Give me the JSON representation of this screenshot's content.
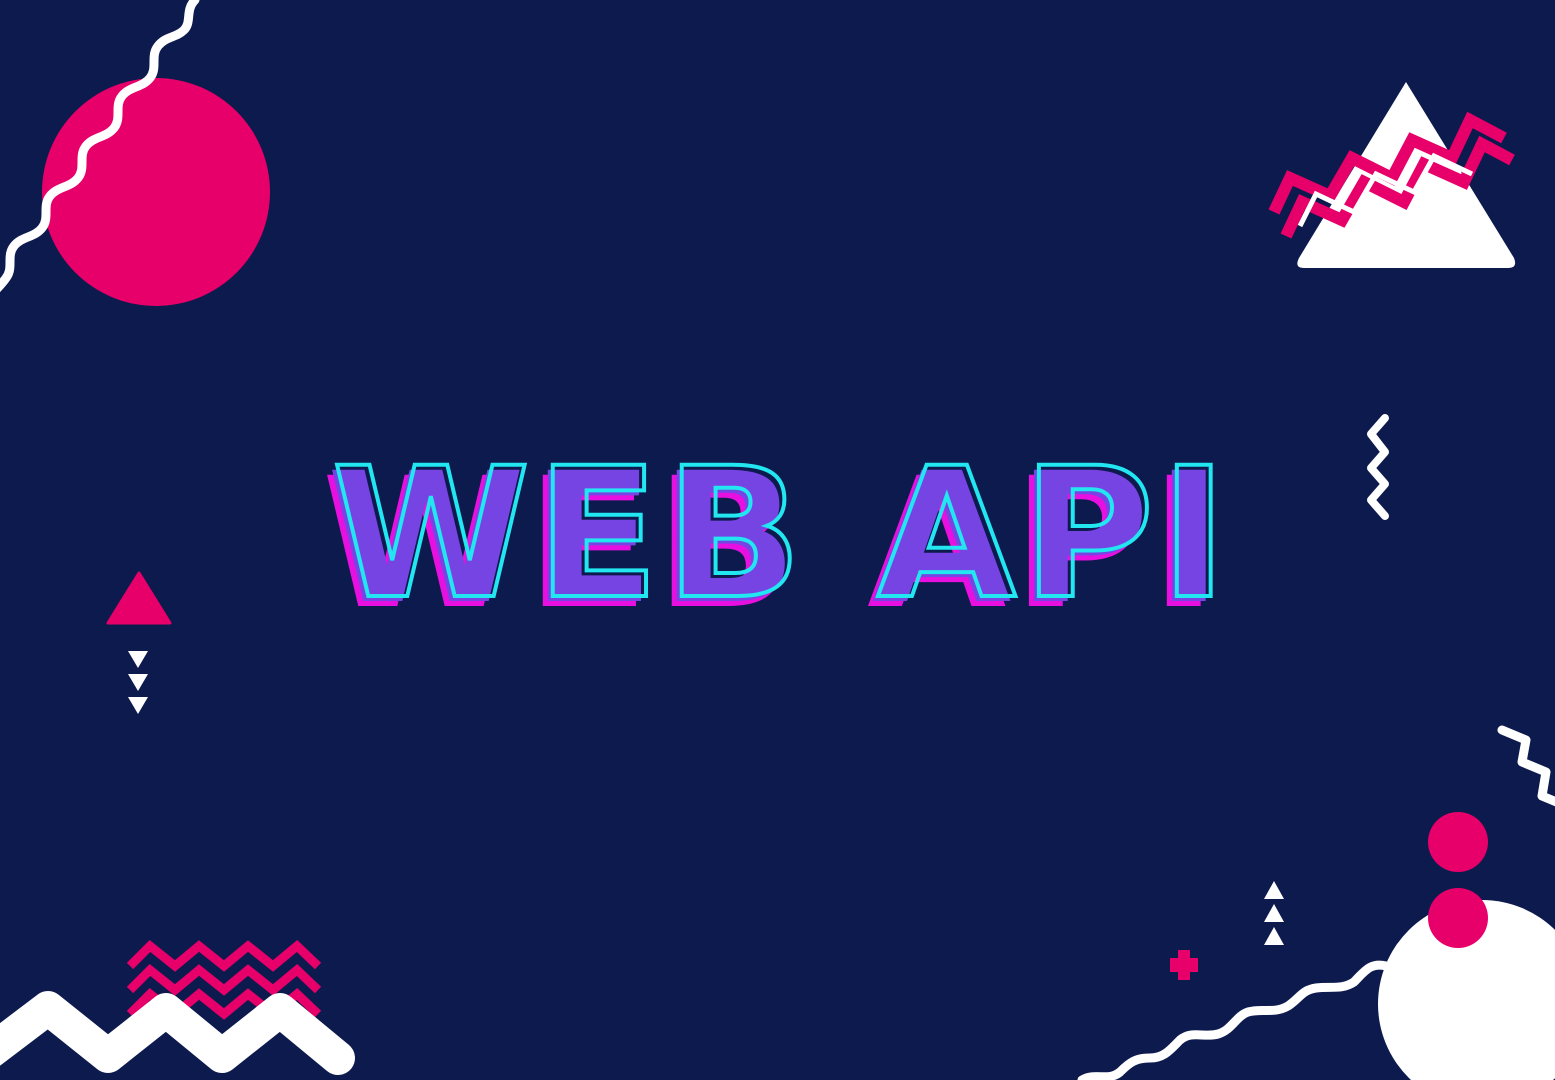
{
  "title": "WEB API",
  "colors": {
    "background": "#0d1a4d",
    "pink": "#e8006a",
    "white": "#ffffff",
    "title_fill": "#7744e4",
    "title_cyan": "#22e6f0",
    "title_magenta": "#e710e0"
  },
  "decorations": [
    "pink-circle",
    "white-squiggle-line",
    "white-triangle",
    "pink-zigzag-stripes",
    "white-zigzag-vertical",
    "pink-small-triangle",
    "white-down-triangles",
    "pink-chevron-pattern",
    "white-zigzag-band",
    "pink-plus",
    "white-up-triangles",
    "white-semicircle",
    "pink-dots",
    "white-wavy-line"
  ]
}
